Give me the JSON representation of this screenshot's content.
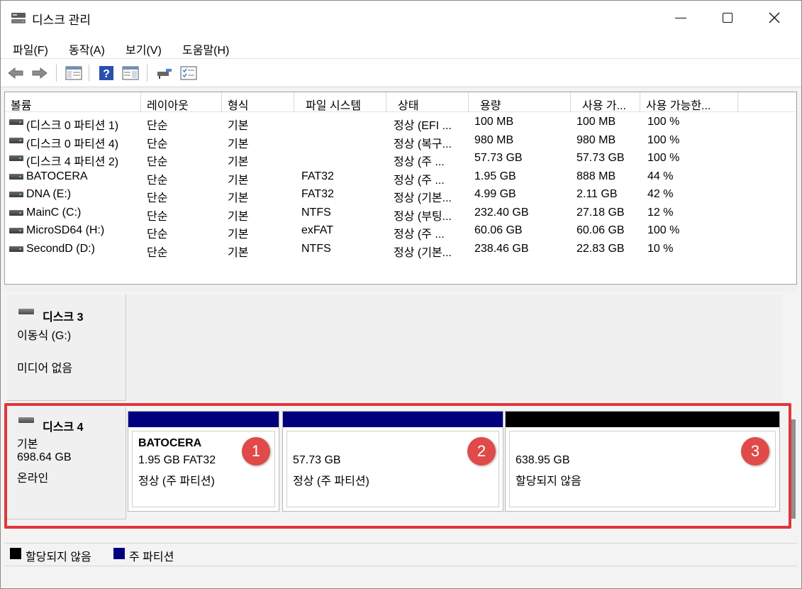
{
  "window": {
    "title": "디스크 관리"
  },
  "menu": [
    "파일(F)",
    "동작(A)",
    "보기(V)",
    "도움말(H)"
  ],
  "toolbar": {
    "buttons": [
      "back-icon",
      "forward-icon",
      "console-tree-icon",
      "help-icon",
      "properties-icon",
      "connect-icon",
      "checklist-icon"
    ]
  },
  "list": {
    "columns": [
      "볼륨",
      "레이아웃",
      "형식",
      "파일 시스템",
      "상태",
      "용량",
      "사용 가...",
      "사용 가능한..."
    ],
    "rows": [
      [
        "(디스크 0 파티션 1)",
        "단순",
        "기본",
        "",
        "정상 (EFI ...",
        "100 MB",
        "100 MB",
        "100 %"
      ],
      [
        "(디스크 0 파티션 4)",
        "단순",
        "기본",
        "",
        "정상 (복구...",
        "980 MB",
        "980 MB",
        "100 %"
      ],
      [
        "(디스크 4 파티션 2)",
        "단순",
        "기본",
        "",
        "정상 (주 ...",
        "57.73 GB",
        "57.73 GB",
        "100 %"
      ],
      [
        "BATOCERA",
        "단순",
        "기본",
        "FAT32",
        "정상 (주 ...",
        "1.95 GB",
        "888 MB",
        "44 %"
      ],
      [
        "DNA (E:)",
        "단순",
        "기본",
        "FAT32",
        "정상 (기본...",
        "4.99 GB",
        "2.11 GB",
        "42 %"
      ],
      [
        "MainC (C:)",
        "단순",
        "기본",
        "NTFS",
        "정상 (부팅...",
        "232.40 GB",
        "27.18 GB",
        "12 %"
      ],
      [
        "MicroSD64 (H:)",
        "단순",
        "기본",
        "exFAT",
        "정상 (주 ...",
        "60.06 GB",
        "60.06 GB",
        "100 %"
      ],
      [
        "SecondD (D:)",
        "단순",
        "기본",
        "NTFS",
        "정상 (기본...",
        "238.46 GB",
        "22.83 GB",
        "10 %"
      ]
    ]
  },
  "disk3": {
    "name": "디스크 3",
    "type": "이동식 (G:)",
    "status": "미디어 없음"
  },
  "disk4": {
    "name": "디스크 4",
    "type": "기본",
    "size": "698.64 GB",
    "status": "온라인",
    "partitions": [
      {
        "label": "BATOCERA",
        "line1": "1.95 GB FAT32",
        "line2": "정상 (주 파티션)",
        "badge": "1",
        "color": "#00007f"
      },
      {
        "label": "",
        "line1": "57.73 GB",
        "line2": "정상 (주 파티션)",
        "badge": "2",
        "color": "#00007f"
      },
      {
        "label": "",
        "line1": "638.95 GB",
        "line2": "할당되지 않음",
        "badge": "3",
        "color": "#000000"
      }
    ]
  },
  "legend": [
    {
      "label": "할당되지 않음",
      "color": "#000000"
    },
    {
      "label": "주 파티션",
      "color": "#00007f"
    }
  ],
  "colors": {
    "highlight": "#e2363a",
    "primary_partition": "#00007f",
    "unallocated": "#000000"
  }
}
